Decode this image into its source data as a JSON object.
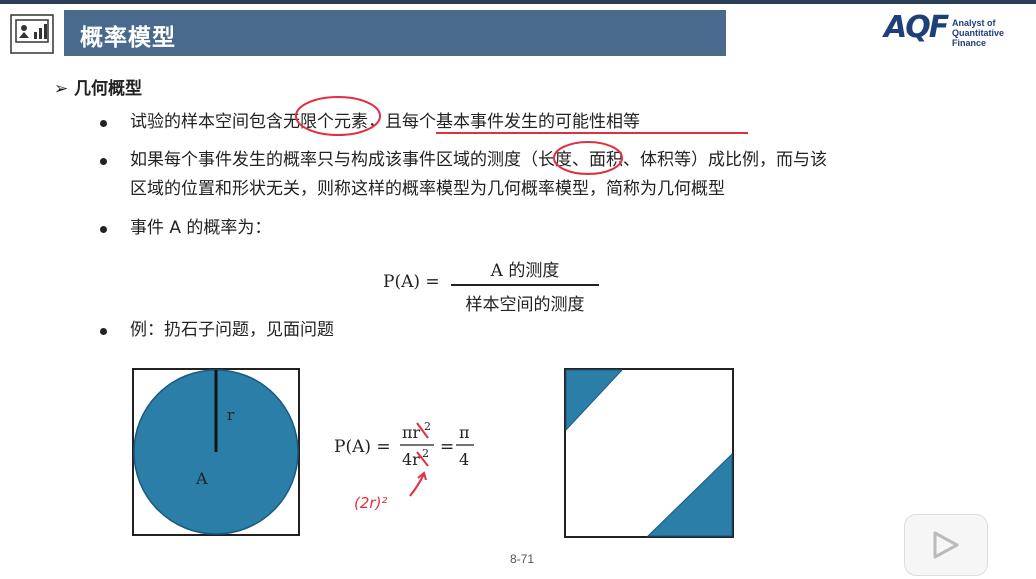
{
  "header": {
    "title": "概率模型",
    "logo": {
      "brand": "AQF",
      "subtitle_line1": "Analyst of",
      "subtitle_line2": "Quantitative Finance"
    }
  },
  "section": {
    "marker": "➢",
    "title": "几何概型"
  },
  "bullets": [
    "试验的样本空间包含无限个元素，且每个基本事件发生的可能性相等",
    "如果每个事件发生的概率只与构成该事件区域的测度（长度、面积、体积等）成比例，而与该",
    "区域的位置和形状无关，则称这样的概率模型为几何概率模型，简称为几何概型",
    "事件 A 的概率为：",
    "例：扔石子问题，见面问题"
  ],
  "formula1": {
    "lhs": "P(A) =",
    "numerator": "A 的测度",
    "denominator": "样本空间的测度"
  },
  "diagram1": {
    "radius_label": "r",
    "region_label": "A",
    "fill": "#2a7ea8"
  },
  "formula2": {
    "lhs": "P(A) =",
    "num1": "πr",
    "den1": "4r",
    "exp": "2",
    "num2": "π",
    "den2": "4",
    "handwritten": "(2r)²"
  },
  "diagram2": {
    "fill": "#2a7ea8"
  },
  "footer": {
    "page": "8-71"
  },
  "colors": {
    "accent": "#4a6a8d",
    "logo": "#1f3f7a",
    "ink": "#e03040",
    "shape": "#2a7ea8"
  },
  "video_overlay": {
    "icon": "play-icon"
  }
}
